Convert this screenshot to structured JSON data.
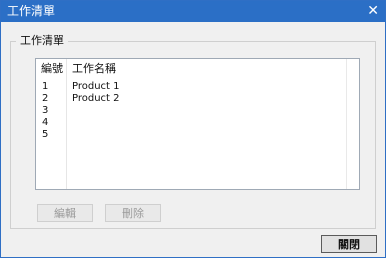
{
  "window": {
    "title": "工作清單",
    "close_glyph": "✕"
  },
  "group": {
    "label": "工作清單"
  },
  "table": {
    "columns": [
      "編號",
      "工作名稱"
    ],
    "rows": [
      {
        "no": "1",
        "name": "Product 1"
      },
      {
        "no": "2",
        "name": "Product 2"
      },
      {
        "no": "3",
        "name": ""
      },
      {
        "no": "4",
        "name": ""
      },
      {
        "no": "5",
        "name": ""
      }
    ]
  },
  "buttons": {
    "edit": "編輯",
    "delete": "刪除",
    "close": "關閉"
  },
  "colors": {
    "titlebar": "#2b6fc6",
    "window_bg": "#f0f0f0"
  }
}
